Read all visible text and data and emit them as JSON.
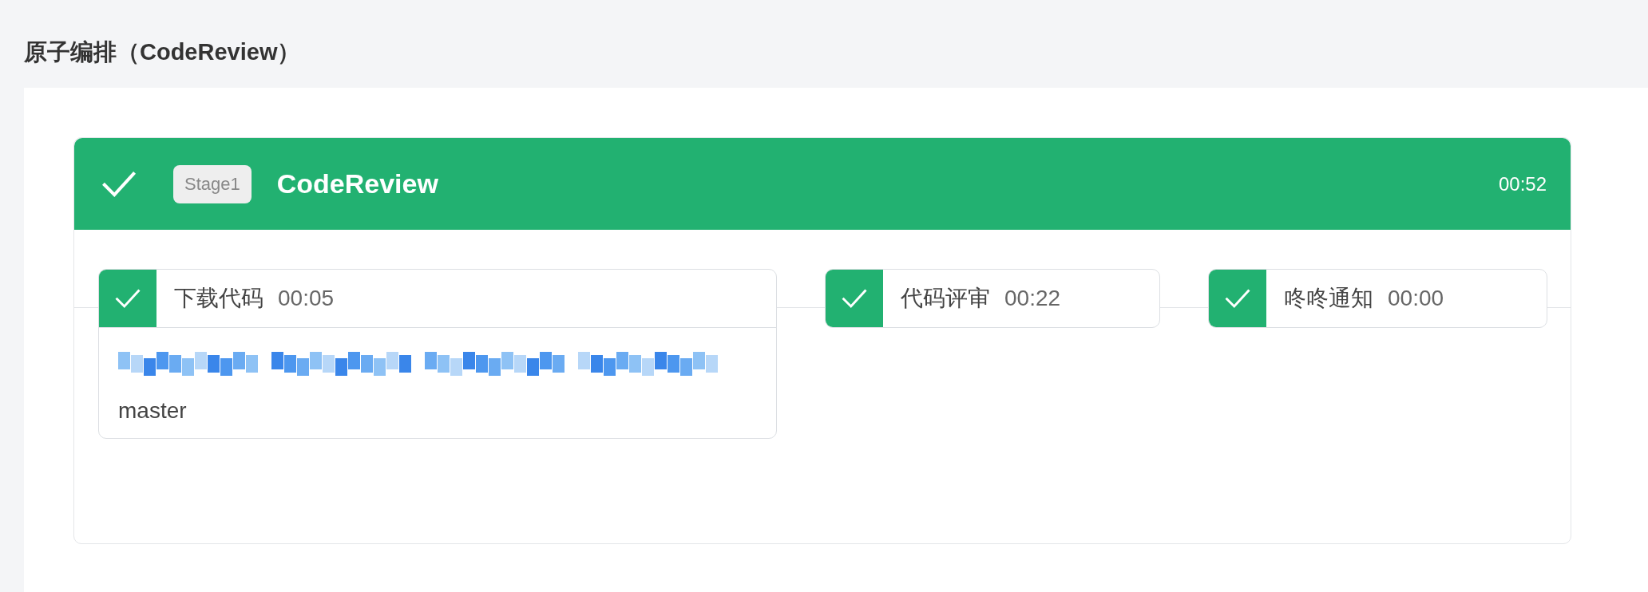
{
  "page_title": "原子编排（CodeReview）",
  "stage": {
    "badge": "Stage1",
    "name": "CodeReview",
    "duration": "00:52",
    "passed": true,
    "jobs": [
      {
        "name": "下载代码",
        "duration": "00:05",
        "passed": true,
        "details": [
          {
            "kind": "redacted"
          },
          {
            "kind": "text",
            "text": "master"
          }
        ]
      },
      {
        "name": "代码评审",
        "duration": "00:22",
        "passed": true
      },
      {
        "name": "咚咚通知",
        "duration": "00:00",
        "passed": true
      }
    ]
  }
}
